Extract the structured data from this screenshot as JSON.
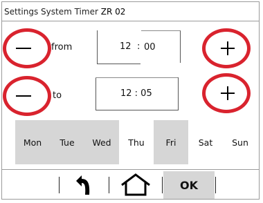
{
  "header": {
    "title_prefix": "Settings System Timer",
    "title_zone": "ZR 02"
  },
  "from_row": {
    "label": "from",
    "hour": "12",
    "separator": ":",
    "minute": "00",
    "minus_icon": "minus-icon",
    "plus_icon": "plus-icon"
  },
  "to_row": {
    "label": "to",
    "time": "12 : 05",
    "minus_icon": "minus-icon",
    "plus_icon": "plus-icon"
  },
  "days": [
    {
      "label": "Mon",
      "selected": true
    },
    {
      "label": "Tue",
      "selected": true
    },
    {
      "label": "Wed",
      "selected": true
    },
    {
      "label": "Thu",
      "selected": false
    },
    {
      "label": "Fri",
      "selected": true
    },
    {
      "label": "Sat",
      "selected": false
    },
    {
      "label": "Sun",
      "selected": false
    }
  ],
  "footer": {
    "back_icon": "back-arrow-icon",
    "home_icon": "home-icon",
    "ok_label": "OK"
  },
  "colors": {
    "accent_red": "#d9232e",
    "selected_gray": "#d6d6d6"
  }
}
